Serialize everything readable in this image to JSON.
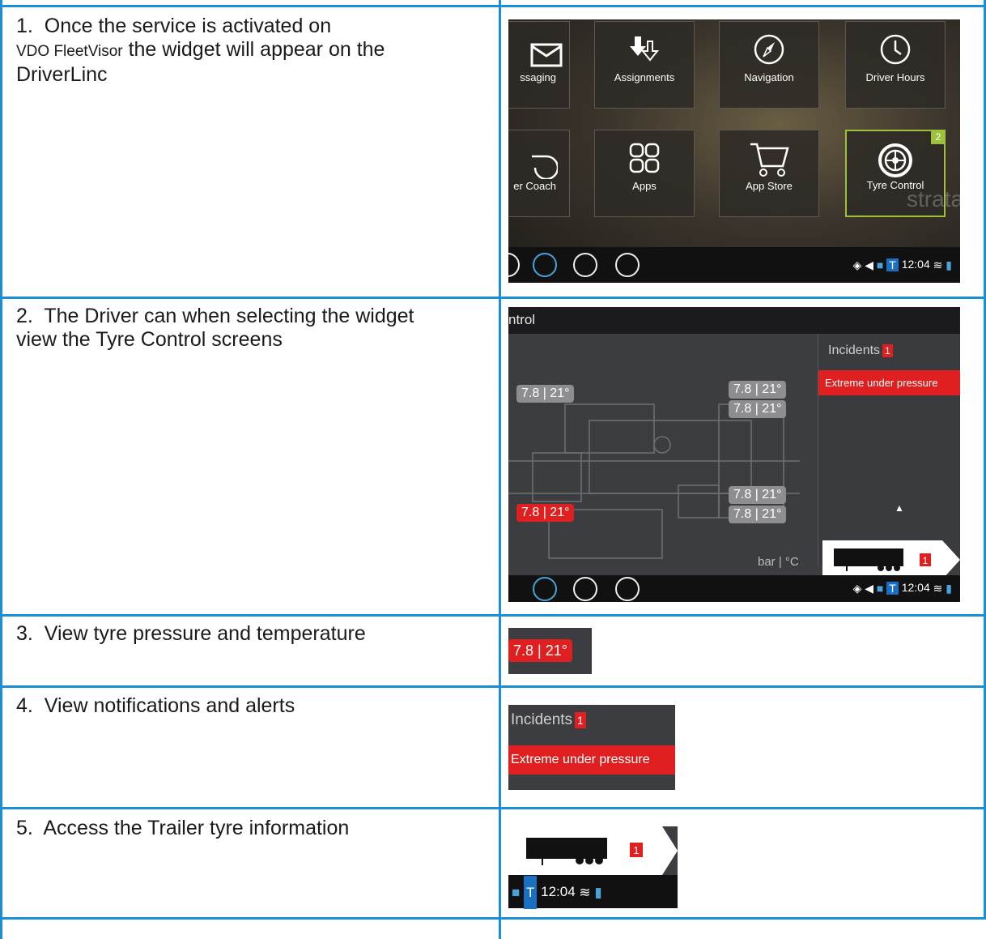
{
  "rows": [
    {
      "num": "1.",
      "text_a": "Once the service is activated on",
      "text_b": "VDO FleetVisor",
      "text_c": " the widget will appear on the",
      "text_d": "DriverLinc"
    },
    {
      "num": "2.",
      "line1": "The Driver can when selecting the widget",
      "line2": "view the Tyre Control screens"
    },
    {
      "num": "3.",
      "text": "View tyre pressure and temperature"
    },
    {
      "num": "4.",
      "text": "View notifications and alerts"
    },
    {
      "num": "5.",
      "text": "Access the Trailer tyre information"
    }
  ],
  "dashboard": {
    "tiles": [
      {
        "label": "ssaging",
        "icon": "envelope-icon"
      },
      {
        "label": "Assignments",
        "icon": "assignments-icon"
      },
      {
        "label": "Navigation",
        "icon": "compass-icon"
      },
      {
        "label": "Driver Hours",
        "icon": "clock-icon"
      },
      {
        "label": "er Coach",
        "icon": "whistle-icon"
      },
      {
        "label": "Apps",
        "icon": "apps-icon"
      },
      {
        "label": "App Store",
        "icon": "cart-icon"
      },
      {
        "label": "Tyre Control",
        "icon": "tyre-icon",
        "badge": "2"
      }
    ],
    "watermark": "strata",
    "time": "12:04"
  },
  "tyre_screen": {
    "title": "ntrol",
    "incidents_label": "Incidents",
    "incidents_count": "1",
    "incident_item": "Extreme under pressure",
    "units": "bar | °C",
    "readings": [
      "7.8 | 21°",
      "7.8 | 21°",
      "7.8 | 21°",
      "7.8 | 21°",
      "7.8 | 21°",
      "7.8 | 21°"
    ],
    "trailer_badge": "1",
    "time": "12:04"
  },
  "crop3": {
    "reading": "7.8 | 21°"
  },
  "crop4": {
    "label": "Incidents",
    "count": "1",
    "item": "Extreme under pressure"
  },
  "crop5": {
    "badge": "1",
    "time": "12:04"
  },
  "colors": {
    "border": "#1a8fd6",
    "alert_red": "#e02020",
    "select_green": "#9dc13b"
  }
}
